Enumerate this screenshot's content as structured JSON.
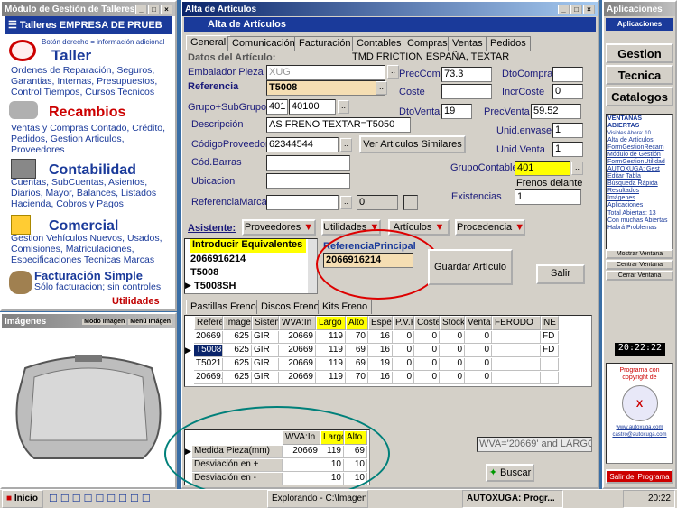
{
  "left": {
    "title": "Módulo de Gestión de Talleres",
    "company": "Talleres EMPRESA DE PRUEB",
    "hint": "Botón derecho = información adicional",
    "taller": {
      "title": "Taller",
      "text": "Ordenes de Reparación, Seguros, Garantias, Internas, Presupuestos, Control Tiempos, Cursos Tecnicos"
    },
    "recambios": {
      "title": "Recambios",
      "text": "Ventas y Compras Contado, Crédito, Pedidos, Gestion Articulos, Proveedores"
    },
    "contabilidad": {
      "title": "Contabilidad",
      "text": "Cuentas, SubCuentas, Asientos, Diarios, Mayor, Balances, Listados Hacienda, Cobros y Pagos"
    },
    "comercial": {
      "title": "Comercial",
      "text": "Gestion Vehículos Nuevos, Usados, Comisiones, Matriculaciones, Especificaciones Tecnicas Marcas"
    },
    "facturacion": {
      "title": "Facturación Simple",
      "text": "Sólo facturacion; sin controles"
    },
    "utilidades": "Utilidades"
  },
  "images": {
    "title": "Imágenes",
    "mode": "Modo Imagen",
    "menu": "Menú Imágen"
  },
  "main": {
    "title": "Alta de Artículos",
    "subtitle": "Alta de Artículos",
    "tabs": [
      "General",
      "Comunicación",
      "Facturación",
      "Contables",
      "Compras",
      "Ventas",
      "Pedidos"
    ],
    "datos_label": "Datos del Artículo:",
    "datos_value": "TMD FRICTION ESPAÑA, TEXTAR",
    "embalador_label": "Embalador Pieza",
    "embalador_value": "XUG",
    "referencia_label": "Referencia",
    "referencia_value": "T5008",
    "grupo_label": "Grupo+SubGrupo",
    "grupo_value": "401",
    "subgrupo_value": "40100",
    "descripcion_label": "Descripción",
    "descripcion_value": "AS FRENO TEXTAR=T5050",
    "codprov_label": "CódigoProveedor",
    "codprov_value": "62344544",
    "verart": "Ver Articulos Similares",
    "codbarras_label": "Cód.Barras",
    "ubicacion_label": "Ubicacion",
    "refmarca_label": "ReferenciaMarca",
    "refmarca_num": "0",
    "preccomp_label": "PrecComp",
    "preccomp_value": "73.3",
    "coste_label": "Coste",
    "dtoventa_label": "DtoVenta",
    "dtoventa_value": "19",
    "dtocompra_label": "DtoCompra",
    "incrcoste_label": "IncrCoste",
    "incrcoste_value": "0",
    "precventa_label": "PrecVenta",
    "precventa_value": "59.52",
    "unidenvase_label": "Unid.envase",
    "unidenvase_value": "1",
    "unidventa_label": "Unid.Venta",
    "unidventa_value": "1",
    "grupocontable_label": "GrupoContable",
    "grupocontable_value": "401",
    "grupocontable_desc": "Frenos delante",
    "existencias_label": "Existencias",
    "existencias_value": "1",
    "asistente": "Asistente:",
    "asist_buttons": [
      "Proveedores",
      "Utilidades",
      "Artículos",
      "Procedencia"
    ],
    "equiv_header": "Introducir Equivalentes",
    "equiv_rows": [
      "2066916214",
      "T5008",
      "T5008SH"
    ],
    "refprinc_label": "ReferenciaPrincipal",
    "refprinc_value": "2066916214",
    "guardar": "Guardar Artículo",
    "salir": "Salir",
    "subtabs": [
      "Pastillas Freno",
      "Discos Freno",
      "Kits Freno"
    ],
    "grid_headers": [
      "Referencia",
      "Imagen",
      "Sistema",
      "WVA:In",
      "Largo",
      "Alto",
      "Espe",
      "P.V.P",
      "Coste",
      "Stock",
      "Venta",
      "FERODO",
      "NE"
    ],
    "grid_rows": [
      [
        "20669",
        "625",
        "GIR",
        "20669",
        "119",
        "70",
        "16",
        "0",
        "0",
        "0",
        "0",
        "",
        "FD"
      ],
      [
        "T5008",
        "625",
        "GIR",
        "20669",
        "119",
        "69",
        "16",
        "0",
        "0",
        "0",
        "0",
        "",
        "FD"
      ],
      [
        "T5021",
        "625",
        "GIR",
        "20669",
        "119",
        "69",
        "19",
        "0",
        "0",
        "0",
        "0",
        "",
        ""
      ],
      [
        "2066916",
        "625",
        "GIR",
        "20669",
        "119",
        "70",
        "16",
        "0",
        "0",
        "0",
        "0",
        "",
        ""
      ]
    ],
    "meas_headers": [
      "WVA:In",
      "Largo",
      "Alto"
    ],
    "meas_rows": [
      [
        "Medida Pieza(mm)",
        "20669",
        "119",
        "69"
      ],
      [
        "Desviación en +",
        "",
        "10",
        "10"
      ],
      [
        "Desviación en -",
        "",
        "10",
        "10"
      ]
    ],
    "query": "WVA='20669' and LARGOS",
    "buscar": "Buscar"
  },
  "right": {
    "title": "Aplicaciones",
    "subtitle": "Aplicaciones",
    "gestion": "Gestion",
    "tecnica": "Tecnica",
    "catalogos": "Catalogos",
    "ventanas_title": "VENTANAS ABIERTAS",
    "visibles": "Visibles Ahora: 10",
    "items": [
      "Alta de Artículos",
      "FormGestionRecam",
      "Módulo de Gestión",
      "FormGestionUtilidad",
      "AUTOXUGA: Gest",
      "Editar Tabla",
      "Búsqueda Rápida",
      "Resultados",
      "Imágenes",
      "Aplicaciones"
    ],
    "total": "Total Abiertas: 13",
    "warning": "Con muchas Abiertas Habrá Problemas",
    "mostrar": "Mostrar Ventana",
    "centrar": "Centrar Ventana",
    "cerrar": "Cerrar Ventana",
    "clock": "20:22:22",
    "copyright": "Programa con copyright de",
    "link1": "www.autoxuga.com",
    "link2": "castro@autoxuga.com",
    "salir": "Salir del Programa"
  },
  "taskbar": {
    "start": "Inicio",
    "task1": "Explorando - C:\\Imagen...",
    "task2": "AUTOXUGA: Progr...",
    "time": "20:22"
  }
}
